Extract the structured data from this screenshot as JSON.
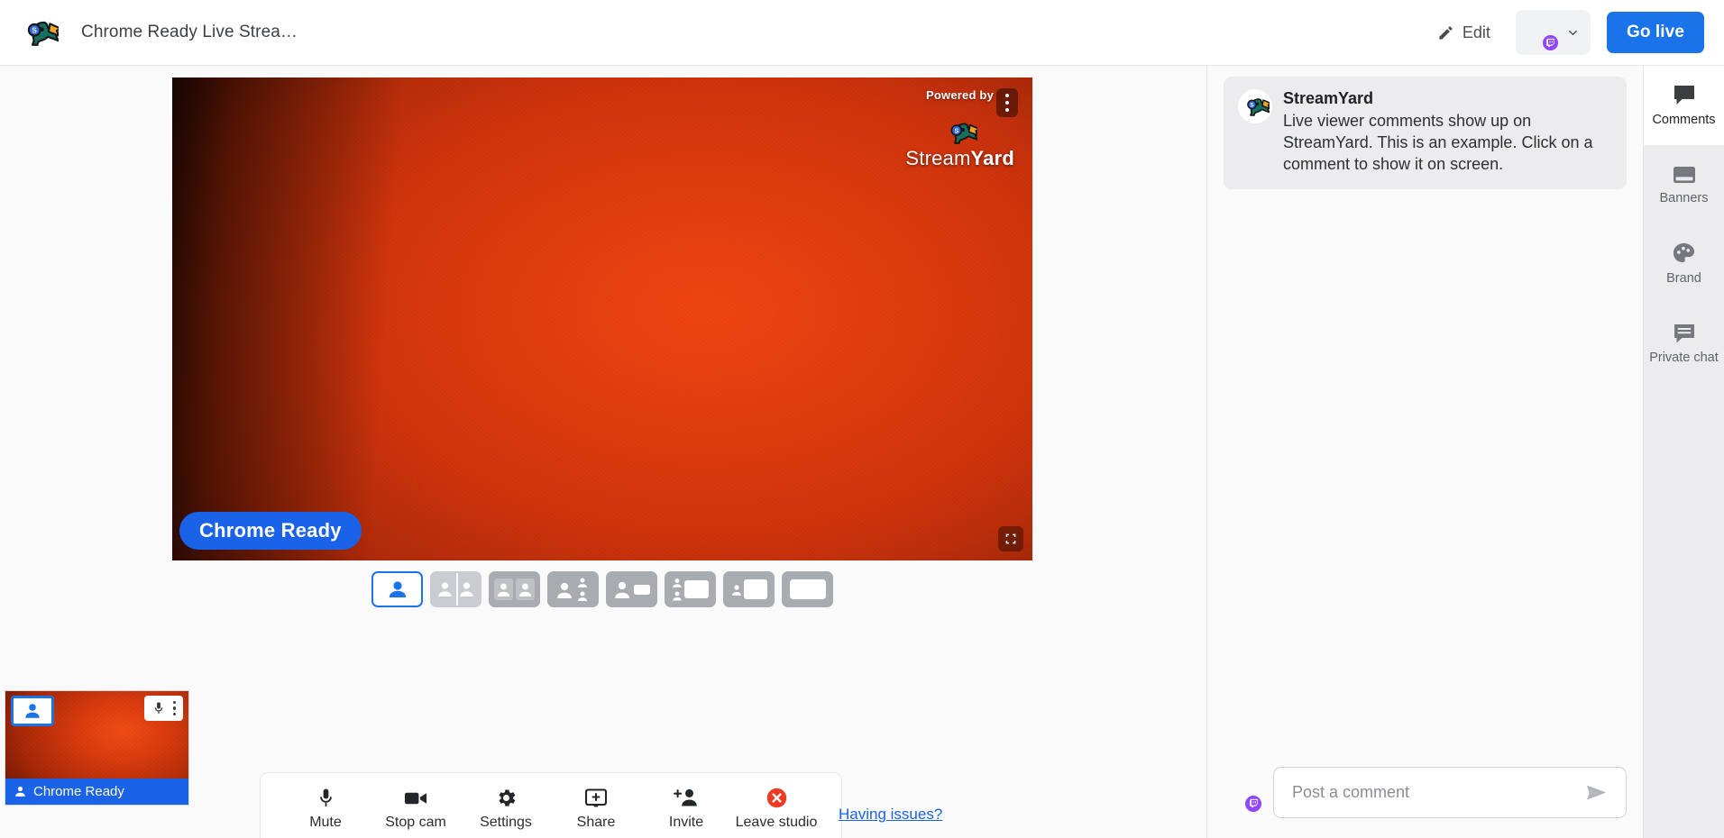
{
  "header": {
    "logo_icon": "streamyard-duck-logo",
    "title": "Chrome Ready Live Strea…",
    "edit_label": "Edit",
    "edit_icon": "pencil-icon",
    "destination_badge": "twitch-icon",
    "destination_chevron": "chevron-down-icon",
    "go_live_label": "Go live"
  },
  "stage": {
    "watermark": {
      "powered_by": "Powered by",
      "brand_first": "Stream",
      "brand_second": "Yard",
      "kebab_icon": "more-vertical-icon",
      "duck_icon": "streamyard-duck-logo"
    },
    "name_pill": "Chrome Ready",
    "expand_icon": "fullscreen-icon",
    "layouts": [
      {
        "name": "layout-solo",
        "icon": "single-person-layout",
        "active": true
      },
      {
        "name": "layout-split-two",
        "icon": "two-person-split-layout",
        "active": false
      },
      {
        "name": "layout-group-two",
        "icon": "two-person-group-layout",
        "active": false
      },
      {
        "name": "layout-one-plus-two",
        "icon": "one-plus-two-layout",
        "active": false
      },
      {
        "name": "layout-person-screen",
        "icon": "person-and-screen-layout",
        "active": false
      },
      {
        "name": "layout-two-stack-screen",
        "icon": "two-stack-and-screen-layout",
        "active": false
      },
      {
        "name": "layout-small-person-screen",
        "icon": "small-person-screen-layout",
        "active": false
      },
      {
        "name": "layout-screen-only",
        "icon": "screen-only-layout",
        "active": false
      }
    ],
    "tile": {
      "on_screen_icon": "add-to-stage-icon",
      "mic_icon": "microphone-icon",
      "menu_icon": "more-vertical-icon",
      "person_icon": "person-icon",
      "name": "Chrome Ready"
    },
    "toolbar": [
      {
        "label": "Mute",
        "icon": "microphone-icon",
        "name": "mute-button"
      },
      {
        "label": "Stop cam",
        "icon": "video-camera-icon",
        "name": "stop-cam-button"
      },
      {
        "label": "Settings",
        "icon": "gear-icon",
        "name": "settings-button"
      },
      {
        "label": "Share",
        "icon": "screen-share-plus-icon",
        "name": "share-button"
      },
      {
        "label": "Invite",
        "icon": "person-add-icon",
        "name": "invite-button"
      },
      {
        "label": "Leave studio",
        "icon": "leave-x-circle-icon",
        "name": "leave-studio-button"
      }
    ],
    "having_issues": "Having issues?"
  },
  "comments": {
    "items": [
      {
        "avatar_icon": "streamyard-duck-logo",
        "author": "StreamYard",
        "text": "Live viewer comments show up on StreamYard. This is an example. Click on a comment to show it on screen."
      }
    ],
    "composer": {
      "avatar_badge": "twitch-icon",
      "placeholder": "Post a comment",
      "value": "",
      "send_icon": "send-icon"
    }
  },
  "rail": {
    "items": [
      {
        "label": "Comments",
        "icon": "comment-bubble-icon",
        "name": "rail-item-comments",
        "active": true
      },
      {
        "label": "Banners",
        "icon": "banner-icon",
        "name": "rail-item-banners",
        "active": false
      },
      {
        "label": "Brand",
        "icon": "palette-icon",
        "name": "rail-item-brand",
        "active": false
      },
      {
        "label": "Private chat",
        "icon": "private-chat-icon",
        "name": "rail-item-private-chat",
        "active": false
      }
    ]
  },
  "colors": {
    "accent_blue": "#1a73e8",
    "twitch_purple": "#9146ff",
    "leave_red": "#ef3b24",
    "link_blue": "#1a63e8"
  }
}
